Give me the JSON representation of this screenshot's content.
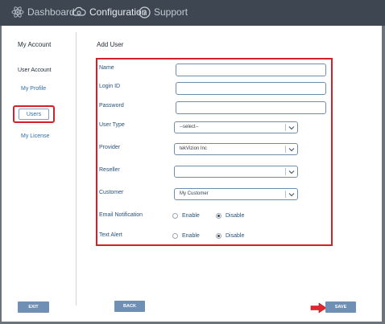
{
  "nav": {
    "dashboard": "Dashboard",
    "configuration": "Configuration",
    "support": "Support"
  },
  "sidebar": {
    "title": "My Account",
    "heading": "User Account",
    "items": [
      {
        "label": "My Profile"
      },
      {
        "label": "Users"
      },
      {
        "label": "My License"
      }
    ]
  },
  "main": {
    "title": "Add User"
  },
  "form": {
    "name_label": "Name",
    "login_label": "Login ID",
    "password_label": "Password",
    "user_type_label": "User Type",
    "user_type_value": "--select--",
    "provider_label": "Provider",
    "provider_value": "tekVizion Inc",
    "reseller_label": "Reseller",
    "reseller_value": "",
    "customer_label": "Customer",
    "customer_value": "My Customer",
    "email_label": "Email Notification",
    "text_alert_label": "Text Alert",
    "enable": "Enable",
    "disable": "Disable",
    "email_selected": "Disable",
    "text_alert_selected": "Disable"
  },
  "buttons": {
    "exit": "EXIT",
    "back": "BACK",
    "save": "SAVE"
  },
  "colors": {
    "highlight": "#d4202a",
    "button": "#6f8fb4",
    "topbar": "#3d4651"
  },
  "icons": {
    "dashboard": "atom-icon",
    "configuration": "gear-cloud-icon",
    "support": "info-icon",
    "arrow": "red-arrow-icon"
  }
}
